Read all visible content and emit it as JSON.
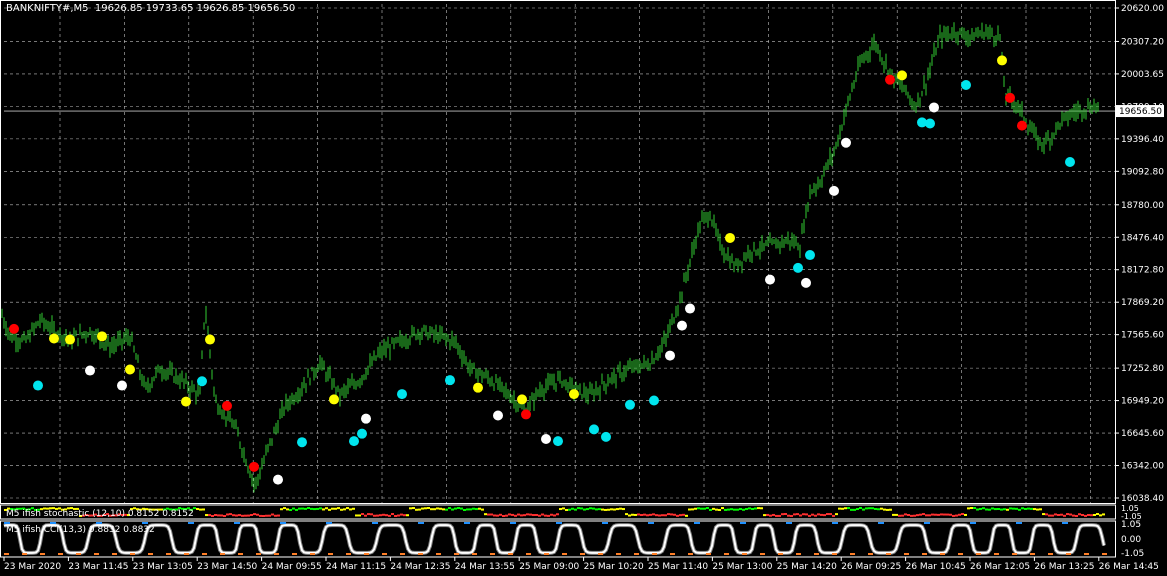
{
  "header": {
    "symbol": "BANKNIFTY#,M5",
    "ohlc": "19626.85 19733.65 19626.85 19656.50"
  },
  "price_axis": {
    "ticks": [
      "20620.00",
      "20307.20",
      "20003.65",
      "19700.10",
      "19396.40",
      "19092.80",
      "18780.00",
      "18476.40",
      "18172.80",
      "17869.20",
      "17565.60",
      "17252.80",
      "16949.20",
      "16645.60",
      "16342.00",
      "16038.40"
    ],
    "current_price_label": "19656.50"
  },
  "indicators": {
    "stochastic": {
      "label": "M5 ifish stochastic (12,10) 0.8152 0.8152",
      "axis_labels": [
        "1.05",
        "-1.05"
      ]
    },
    "cci": {
      "label": "M5 ifish CCI(13,3) 0.8832 0.8832",
      "axis_labels": [
        "1.05",
        "0.00",
        "-1.05"
      ]
    }
  },
  "time_axis": {
    "labels": [
      "23 Mar 2020",
      "23 Mar 11:45",
      "23 Mar 13:05",
      "23 Mar 14:50",
      "24 Mar 09:55",
      "24 Mar 11:15",
      "24 Mar 12:35",
      "24 Mar 13:55",
      "25 Mar 09:00",
      "25 Mar 10:20",
      "25 Mar 11:40",
      "25 Mar 13:00",
      "25 Mar 14:20",
      "26 Mar 09:25",
      "26 Mar 10:45",
      "26 Mar 12:05",
      "26 Mar 13:25",
      "26 Mar 14:45"
    ]
  },
  "colors": {
    "background": "#000000",
    "grid": "#c0c0c0",
    "candle": "#32cd32",
    "text": "#ffffff",
    "signal_red": "#ff0000",
    "signal_yellow": "#ffff00",
    "signal_white": "#ffffff",
    "signal_cyan": "#00e5ee",
    "cci_line": "#ffffff",
    "cci_orange": "#ff7f27",
    "cci_blue": "#1e90ff",
    "stoch_green": "#00ff00",
    "stoch_yellow": "#ffff00",
    "stoch_red": "#ff3030"
  },
  "chart_data": {
    "type": "line",
    "title": "BANKNIFTY#,M5",
    "ylim": [
      16000,
      20700
    ],
    "price_path": [
      [
        0,
        17800
      ],
      [
        10,
        17550
      ],
      [
        25,
        17500
      ],
      [
        40,
        17700
      ],
      [
        55,
        17600
      ],
      [
        70,
        17520
      ],
      [
        90,
        17600
      ],
      [
        110,
        17450
      ],
      [
        130,
        17550
      ],
      [
        145,
        17050
      ],
      [
        160,
        17250
      ],
      [
        180,
        17150
      ],
      [
        200,
        17000
      ],
      [
        205,
        17850
      ],
      [
        215,
        16950
      ],
      [
        235,
        16700
      ],
      [
        255,
        16150
      ],
      [
        270,
        16550
      ],
      [
        285,
        16900
      ],
      [
        300,
        17050
      ],
      [
        320,
        17300
      ],
      [
        340,
        17000
      ],
      [
        360,
        17150
      ],
      [
        380,
        17400
      ],
      [
        400,
        17500
      ],
      [
        420,
        17600
      ],
      [
        440,
        17550
      ],
      [
        455,
        17500
      ],
      [
        470,
        17250
      ],
      [
        490,
        17150
      ],
      [
        510,
        17000
      ],
      [
        525,
        16850
      ],
      [
        540,
        17050
      ],
      [
        560,
        17150
      ],
      [
        575,
        17050
      ],
      [
        590,
        17000
      ],
      [
        610,
        17150
      ],
      [
        630,
        17250
      ],
      [
        650,
        17300
      ],
      [
        665,
        17500
      ],
      [
        680,
        17900
      ],
      [
        700,
        18600
      ],
      [
        710,
        18700
      ],
      [
        720,
        18400
      ],
      [
        735,
        18200
      ],
      [
        750,
        18350
      ],
      [
        770,
        18400
      ],
      [
        790,
        18450
      ],
      [
        800,
        18400
      ],
      [
        810,
        18900
      ],
      [
        820,
        19000
      ],
      [
        835,
        19300
      ],
      [
        850,
        19800
      ],
      [
        860,
        20100
      ],
      [
        875,
        20300
      ],
      [
        885,
        20100
      ],
      [
        895,
        19950
      ],
      [
        905,
        19850
      ],
      [
        915,
        19700
      ],
      [
        925,
        19900
      ],
      [
        940,
        20350
      ],
      [
        955,
        20400
      ],
      [
        970,
        20350
      ],
      [
        985,
        20400
      ],
      [
        1000,
        20350
      ],
      [
        1005,
        19800
      ],
      [
        1015,
        19750
      ],
      [
        1030,
        19500
      ],
      [
        1040,
        19350
      ],
      [
        1050,
        19400
      ],
      [
        1060,
        19550
      ],
      [
        1075,
        19650
      ],
      [
        1090,
        19700
      ],
      [
        1100,
        19700
      ]
    ],
    "signals": [
      {
        "x": 14,
        "price": 17620,
        "color": "red"
      },
      {
        "x": 38,
        "price": 17090,
        "color": "cyan"
      },
      {
        "x": 54,
        "price": 17530,
        "color": "yellow"
      },
      {
        "x": 70,
        "price": 17520,
        "color": "yellow"
      },
      {
        "x": 90,
        "price": 17230,
        "color": "white"
      },
      {
        "x": 102,
        "price": 17550,
        "color": "yellow"
      },
      {
        "x": 122,
        "price": 17090,
        "color": "white"
      },
      {
        "x": 130,
        "price": 17240,
        "color": "yellow"
      },
      {
        "x": 186,
        "price": 16940,
        "color": "yellow"
      },
      {
        "x": 202,
        "price": 17130,
        "color": "cyan"
      },
      {
        "x": 210,
        "price": 17520,
        "color": "yellow"
      },
      {
        "x": 227,
        "price": 16900,
        "color": "red"
      },
      {
        "x": 254,
        "price": 16330,
        "color": "red"
      },
      {
        "x": 278,
        "price": 16210,
        "color": "white"
      },
      {
        "x": 302,
        "price": 16560,
        "color": "cyan"
      },
      {
        "x": 334,
        "price": 16960,
        "color": "yellow"
      },
      {
        "x": 354,
        "price": 16570,
        "color": "cyan"
      },
      {
        "x": 362,
        "price": 16640,
        "color": "cyan"
      },
      {
        "x": 366,
        "price": 16780,
        "color": "white"
      },
      {
        "x": 402,
        "price": 17010,
        "color": "cyan"
      },
      {
        "x": 450,
        "price": 17140,
        "color": "cyan"
      },
      {
        "x": 478,
        "price": 17070,
        "color": "yellow"
      },
      {
        "x": 498,
        "price": 16810,
        "color": "white"
      },
      {
        "x": 522,
        "price": 16960,
        "color": "yellow"
      },
      {
        "x": 526,
        "price": 16820,
        "color": "red"
      },
      {
        "x": 546,
        "price": 16590,
        "color": "white"
      },
      {
        "x": 558,
        "price": 16570,
        "color": "cyan"
      },
      {
        "x": 574,
        "price": 17010,
        "color": "yellow"
      },
      {
        "x": 594,
        "price": 16680,
        "color": "cyan"
      },
      {
        "x": 606,
        "price": 16610,
        "color": "cyan"
      },
      {
        "x": 630,
        "price": 16910,
        "color": "cyan"
      },
      {
        "x": 654,
        "price": 16950,
        "color": "cyan"
      },
      {
        "x": 670,
        "price": 17370,
        "color": "white"
      },
      {
        "x": 682,
        "price": 17650,
        "color": "white"
      },
      {
        "x": 690,
        "price": 17810,
        "color": "white"
      },
      {
        "x": 730,
        "price": 18470,
        "color": "yellow"
      },
      {
        "x": 770,
        "price": 18080,
        "color": "white"
      },
      {
        "x": 798,
        "price": 18190,
        "color": "cyan"
      },
      {
        "x": 806,
        "price": 18050,
        "color": "white"
      },
      {
        "x": 810,
        "price": 18310,
        "color": "cyan"
      },
      {
        "x": 834,
        "price": 18910,
        "color": "white"
      },
      {
        "x": 846,
        "price": 19360,
        "color": "white"
      },
      {
        "x": 890,
        "price": 19950,
        "color": "red"
      },
      {
        "x": 902,
        "price": 19990,
        "color": "yellow"
      },
      {
        "x": 922,
        "price": 19550,
        "color": "cyan"
      },
      {
        "x": 930,
        "price": 19540,
        "color": "cyan"
      },
      {
        "x": 934,
        "price": 19690,
        "color": "white"
      },
      {
        "x": 966,
        "price": 19900,
        "color": "cyan"
      },
      {
        "x": 1002,
        "price": 20130,
        "color": "yellow"
      },
      {
        "x": 1010,
        "price": 19780,
        "color": "red"
      },
      {
        "x": 1022,
        "price": 19520,
        "color": "red"
      },
      {
        "x": 1070,
        "price": 19180,
        "color": "cyan"
      }
    ]
  }
}
